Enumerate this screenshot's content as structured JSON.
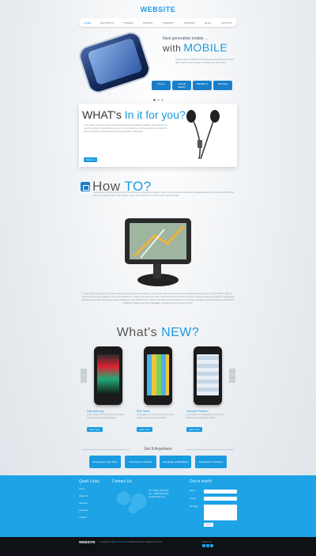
{
  "header": {
    "logo": "WEBSITE",
    "nav": [
      "HOME",
      "PRODUCTS",
      "STORES",
      "PRICING",
      "COMPANY",
      "SUPPORT",
      "BLOG",
      "CONTACT"
    ]
  },
  "hero": {
    "eyebrow": "Next generation mobile ...",
    "title_prefix": "with",
    "title_main": "MOBILE",
    "text": "Sample offers full featured and dedicated applications for all your daily needs, for free sample. It will take over all of these.",
    "stores": [
      "iPhone",
      "Android Market",
      "BlackBerry",
      "Windows"
    ]
  },
  "whats_in": {
    "title_prefix": "WHAT's",
    "title_main": "In it for you?",
    "text": "Lorem Ipsum is simply dummy text of the printing and typesetting industry. Lorem Ipsum has been the industry's standard dummy text. It has survived not only five centuries, but also the leap into electronic typesetting, remaining essentially unchanged.",
    "more": "Find out"
  },
  "howto": {
    "title_prefix": "How",
    "title_main": "TO?",
    "text": "Lorem Ipsum is simply dummy text of the printing and typesetting industry. Lorem Ipsum has been the industry's standard dummy text ever since the 1500s, when an unknown printer took a galley of type and scrambled it to make a type specimen book.",
    "body": "Lorem Ipsum is simply dummy text of the printing and typesetting industry. Lorem Ipsum has been the industry's standard dummy text ever since the 1500s, when an unknown printer took a galley of type and scrambled it to make a type specimen book. It has survived not only five centuries, but also the leap into electronic typesetting, remaining essentially unchanged. It was popularised in the 1960s with the release of Letraset sheets containing Lorem Ipsum passages, and more recently with desktop publishing software like Aldus PageMaker including versions of Lorem Ipsum."
  },
  "whats_new": {
    "title_prefix": "What's",
    "title_main": "NEW?",
    "products": [
      {
        "name": "Intermobil App",
        "desc": "Lorem Ipsum is simply dummy text of the printing and typesetting industry.",
        "more": "read more"
      },
      {
        "name": "BSD Tablet",
        "desc": "Lorem Ipsum is simply dummy text of the printing and typesetting industry.",
        "more": "read more"
      },
      {
        "name": "Vozmash Platform",
        "desc": "Lorem Ipsum is simply dummy text of the printing and typesetting industry.",
        "more": "read more"
      }
    ]
  },
  "get_it": {
    "title": "Get It Anywhere",
    "buttons": [
      "Download on App Store",
      "Download on Android",
      "Download on BlackBerry",
      "Download on Windows"
    ]
  },
  "footer": {
    "quick_links_title": "Quick Links",
    "quick_links": [
      "Home",
      "About Us",
      "Services",
      "Solutions",
      "Contact"
    ],
    "contact_title": "Contact Us",
    "contact_lines": [
      "Tel: 1 (855) 000-0000",
      "Fax: 1 (855) 000-0000",
      "info@website.com"
    ],
    "touch_title": "Get in touch!",
    "form_labels": [
      "Name",
      "E-mail",
      "Message"
    ],
    "submit": "Submit"
  },
  "bottom": {
    "logo": "WEBSITE",
    "copyright_prefix": "Copyright © 2011",
    "copyright_link": "XYZ Solutions",
    "copyright_suffix": "Released under Creative Commons",
    "follow": "Follow Us"
  }
}
